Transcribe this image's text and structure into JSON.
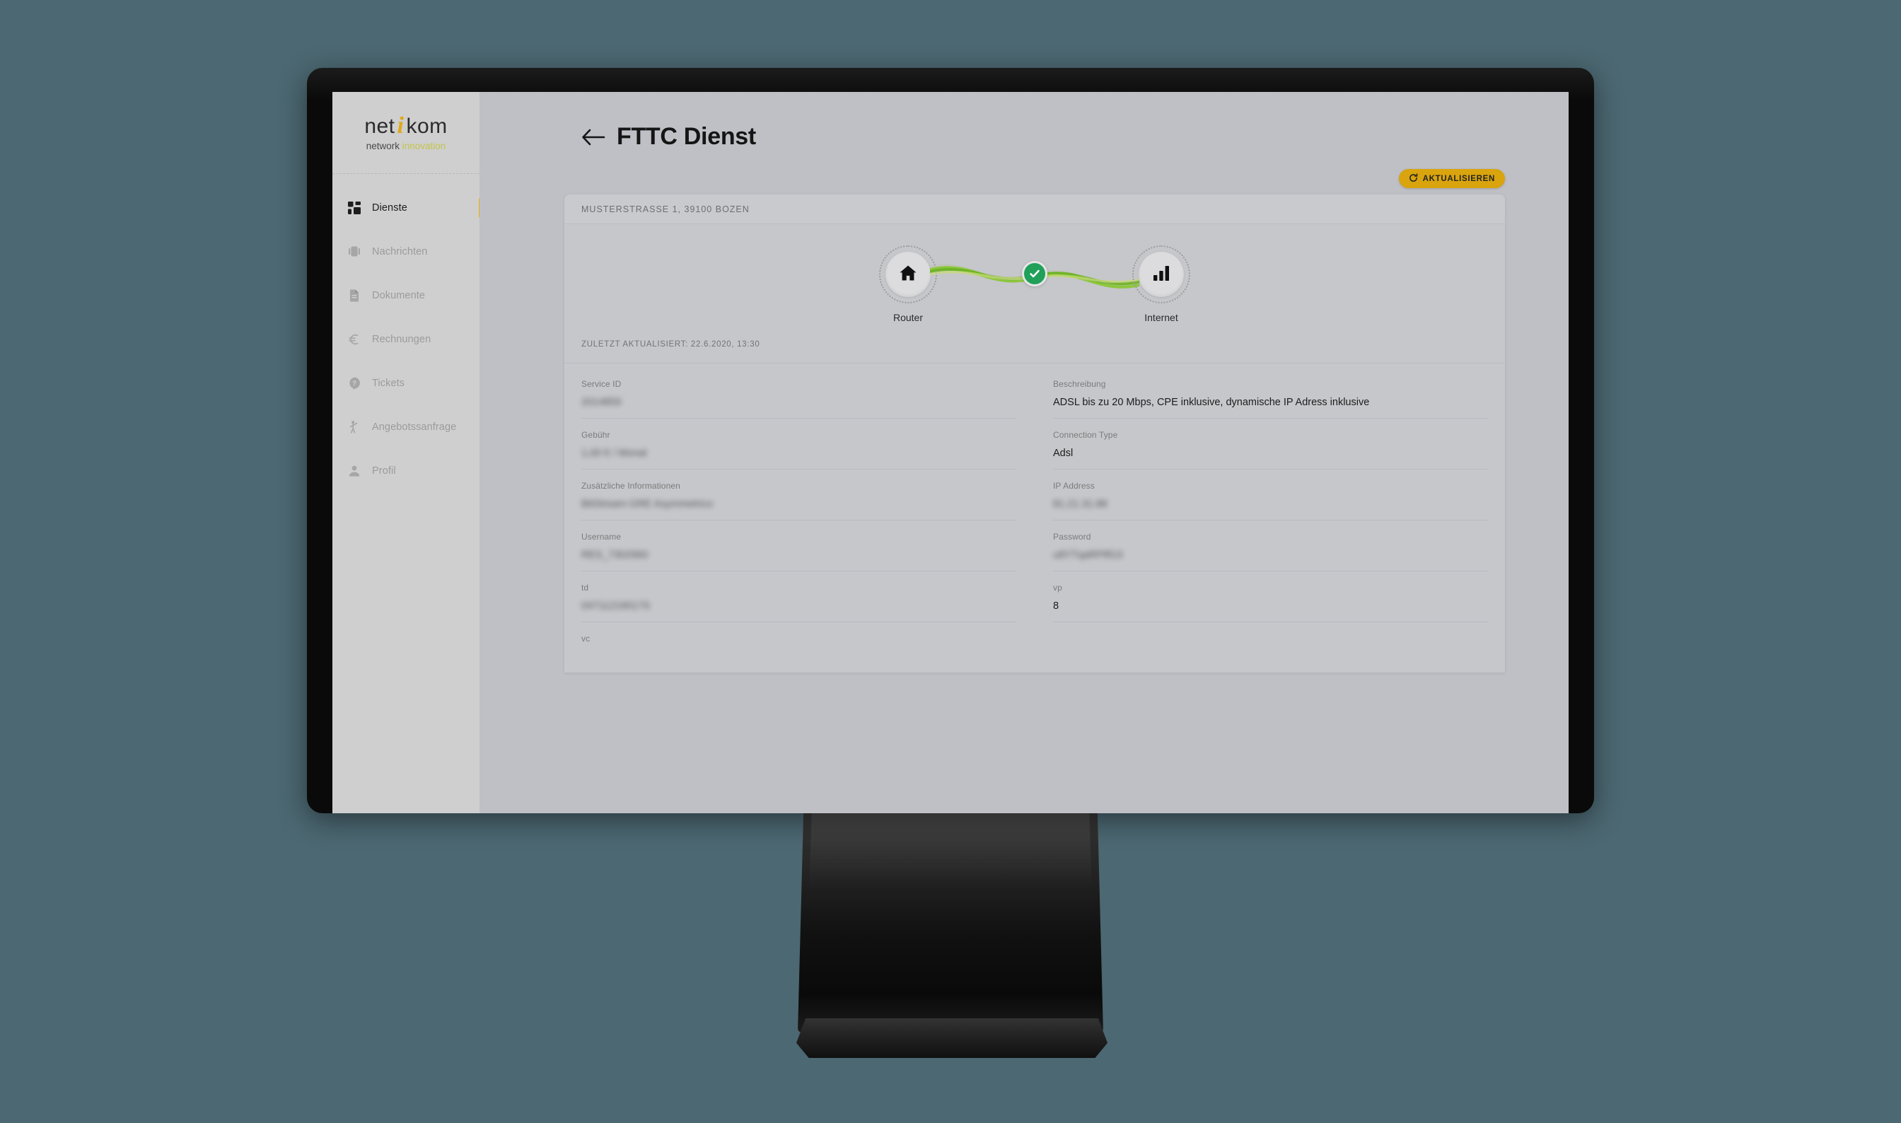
{
  "theme": {
    "page_background": "#4c6872",
    "screen_background": "#bfc0c6",
    "sidebar_background": "#cfcfcf",
    "accent_gold": "#d9a40d",
    "active_indicator": "#e3b60c",
    "status_green": "#21a05a",
    "link_green_light": "#8dc63f",
    "link_green_dark": "#6ab023"
  },
  "sidebar": {
    "logo": {
      "word_1": "net",
      "word_i": "i",
      "word_2": "kom",
      "tagline_1": "network",
      "tagline_2": "innovation"
    },
    "items": [
      {
        "label": "Dienste",
        "icon": "grid-icon",
        "active": true
      },
      {
        "label": "Nachrichten",
        "icon": "chat-icon",
        "active": false
      },
      {
        "label": "Dokumente",
        "icon": "document-icon",
        "active": false
      },
      {
        "label": "Rechnungen",
        "icon": "euro-icon",
        "active": false
      },
      {
        "label": "Tickets",
        "icon": "question-bubble-icon",
        "active": false
      },
      {
        "label": "Angebotssanfrage",
        "icon": "person-waving-icon",
        "active": false
      },
      {
        "label": "Profil",
        "icon": "person-icon",
        "active": false
      }
    ]
  },
  "header": {
    "back_icon": "back-arrow-icon",
    "title": "FTTC Dienst"
  },
  "toolbar": {
    "refresh_label": "AKTUALISIEREN",
    "refresh_icon": "refresh-icon"
  },
  "card": {
    "address": "MUSTERSTRASSE 1, 39100 BOZEN",
    "status": {
      "left_node": {
        "label": "Router",
        "icon": "home-icon"
      },
      "right_node": {
        "label": "Internet",
        "icon": "signal-bars-icon"
      },
      "connection_state_icon": "check-circle-icon",
      "connection_ok": true
    },
    "last_updated_label": "ZULETZT AKTUALISIERT:",
    "last_updated_value": "22.6.2020, 13:30",
    "last_updated_full": "ZULETZT AKTUALISIERT: 22.6.2020, 13:30",
    "fields": [
      {
        "label": "Service ID",
        "value": "2014859",
        "redacted": true
      },
      {
        "label": "Beschreibung",
        "value": "ADSL bis zu 20 Mbps, CPE inklusive, dynamische IP Adress inklusive",
        "redacted": false
      },
      {
        "label": "Gebühr",
        "value": "1,00 € / Monat",
        "redacted": true
      },
      {
        "label": "Connection Type",
        "value": "Adsl",
        "redacted": false
      },
      {
        "label": "Zusätzliche Informationen",
        "value": "BitStream GRE Asymmetrico",
        "redacted": true
      },
      {
        "label": "IP Address",
        "value": "81.21.31.88",
        "redacted": true
      },
      {
        "label": "Username",
        "value": "RES_7302960",
        "redacted": true
      },
      {
        "label": "Password",
        "value": "u8YTqaRPtfG3",
        "redacted": true
      },
      {
        "label": "td",
        "value": "04711219017S",
        "redacted": true
      },
      {
        "label": "vp",
        "value": "8",
        "redacted": false
      },
      {
        "label": "vc",
        "value": "",
        "redacted": false
      }
    ]
  }
}
